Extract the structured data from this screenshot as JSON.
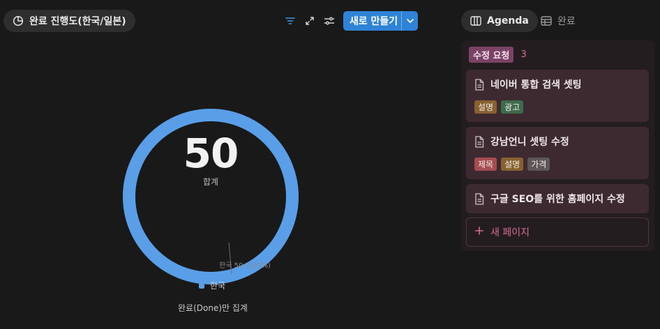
{
  "header": {
    "chart_view_title": "완료 진행도(한국/일본)",
    "new_button_label": "새로 만들기"
  },
  "right_tabs": [
    {
      "label": "Agenda",
      "icon": "columns-icon",
      "active": true
    },
    {
      "label": "완료",
      "icon": "table-icon",
      "active": false
    }
  ],
  "chart": {
    "total_value": "50",
    "total_label": "합계",
    "slice_label": "한국  50 (100%)",
    "legend_label": "한국",
    "footnote": "완료(Done)만 집계"
  },
  "chart_data": {
    "type": "pie",
    "categories": [
      "한국"
    ],
    "values": [
      50
    ],
    "color": "#5a9ee8"
  },
  "board": {
    "status_label": "수정 요청",
    "count": "3",
    "cards": [
      {
        "title": "네이버 통합 검색 셋팅",
        "tags": [
          "설명",
          "광고"
        ]
      },
      {
        "title": "강남언니  셋팅 수정",
        "tags": [
          "제목",
          "설명",
          "가격"
        ]
      },
      {
        "title": "구글 SEO를 위한 홈페이지 수정",
        "tags": []
      }
    ],
    "new_page_label": "새 페이지"
  },
  "colors": {
    "accent": "#2f83d6",
    "chart": "#5a9ee8",
    "status_tag": "#7b4264",
    "tag_설명": "#87622f",
    "tag_광고": "#3f6b4c",
    "tag_제목": "#a54b52",
    "tag_가격": "#5e5657"
  }
}
